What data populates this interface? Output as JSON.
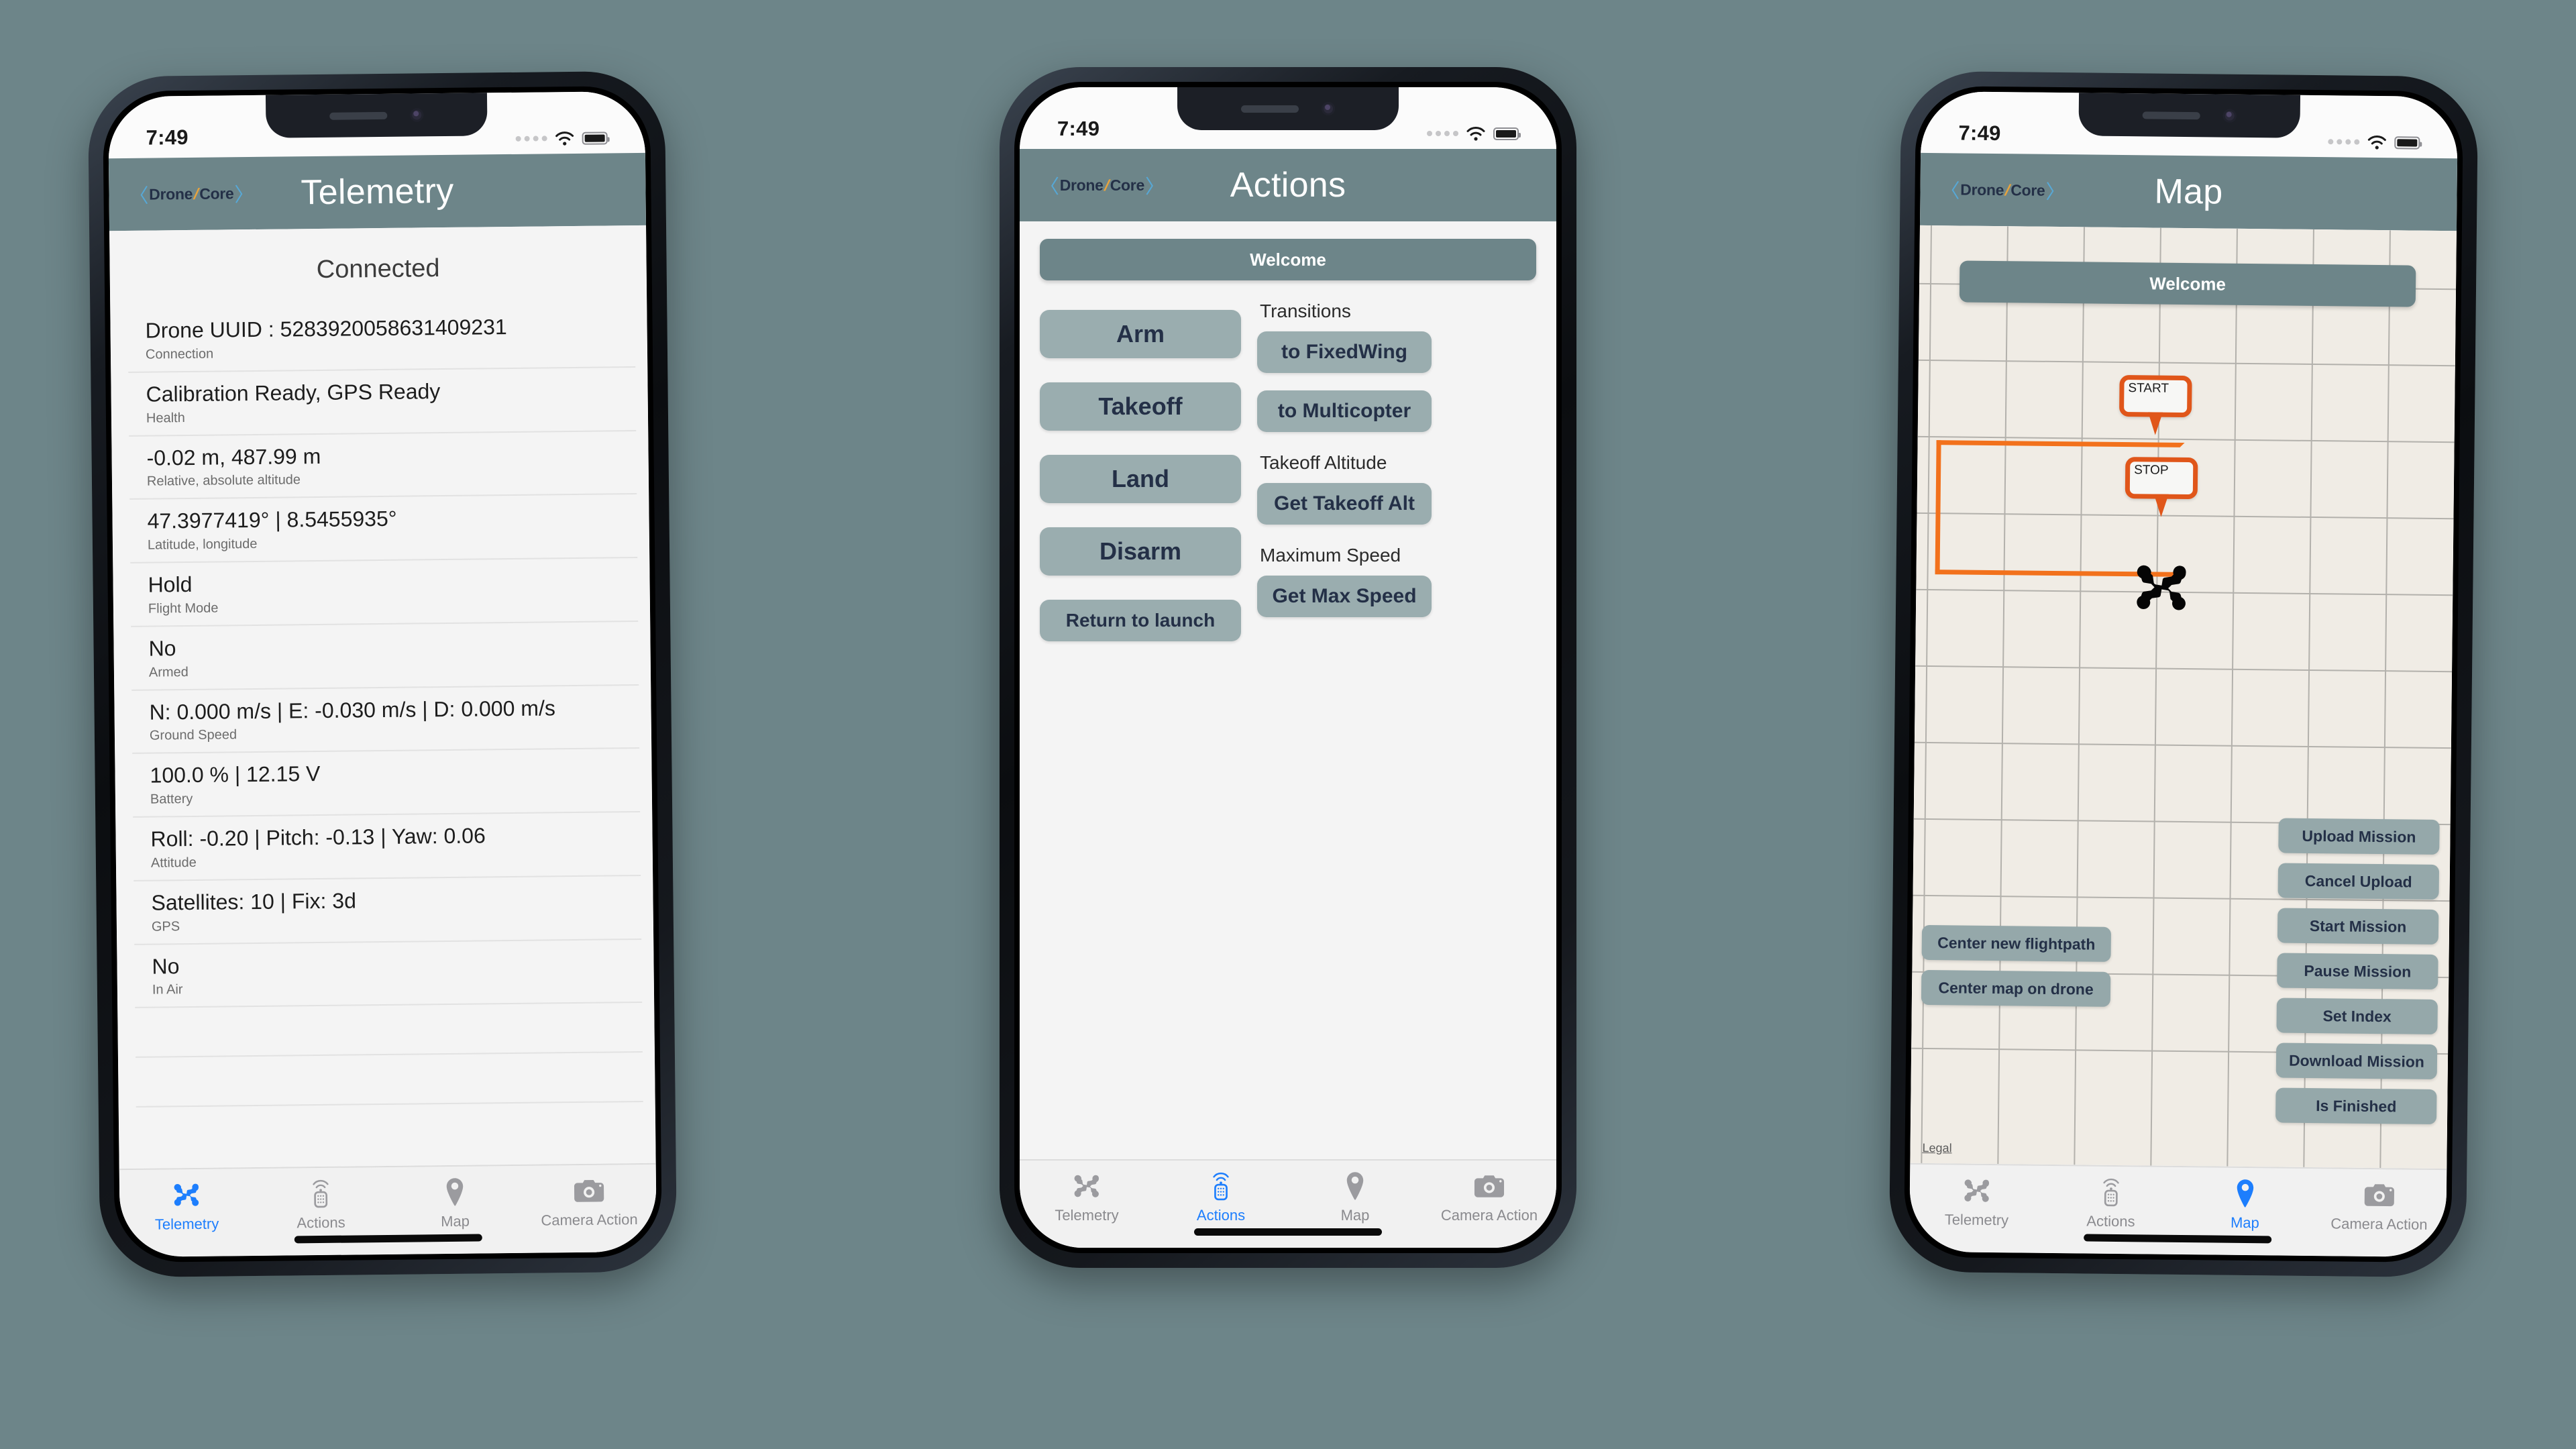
{
  "background_color": "#6d8589",
  "accent_color": "#6d8589",
  "button_color": "#9aadaf",
  "active_tab_color": "#1d7efd",
  "flightpath_color": "#f2711c",
  "status_bar": {
    "time": "7:49"
  },
  "brand": {
    "open_bracket": "〈",
    "first": "Drone",
    "slash": "/",
    "second": "Core",
    "close_bracket": "〉"
  },
  "tabs": [
    {
      "label": "Telemetry",
      "icon": "drone-icon"
    },
    {
      "label": "Actions",
      "icon": "remote-control-icon"
    },
    {
      "label": "Map",
      "icon": "map-pin-icon"
    },
    {
      "label": "Camera Action",
      "icon": "camera-icon"
    }
  ],
  "phone1": {
    "nav_title": "Telemetry",
    "active_tab": "Telemetry",
    "connection_status": "Connected",
    "rows": [
      {
        "value": "Drone UUID : 5283920058631409231",
        "label": "Connection"
      },
      {
        "value": "Calibration Ready, GPS Ready",
        "label": "Health"
      },
      {
        "value": "-0.02 m, 487.99 m",
        "label": "Relative, absolute altitude"
      },
      {
        "value": "47.3977419° | 8.5455935°",
        "label": "Latitude, longitude"
      },
      {
        "value": "Hold",
        "label": "Flight Mode"
      },
      {
        "value": "No",
        "label": "Armed"
      },
      {
        "value": "N: 0.000 m/s | E: -0.030 m/s | D: 0.000 m/s",
        "label": "Ground Speed"
      },
      {
        "value": "100.0 % | 12.15 V",
        "label": "Battery"
      },
      {
        "value": "Roll: -0.20 | Pitch: -0.13 | Yaw: 0.06",
        "label": "Attitude"
      },
      {
        "value": "Satellites: 10 | Fix: 3d",
        "label": "GPS"
      },
      {
        "value": "No",
        "label": "In Air"
      }
    ]
  },
  "phone2": {
    "nav_title": "Actions",
    "active_tab": "Actions",
    "welcome_banner": "Welcome",
    "primary_buttons": [
      {
        "label": "Arm"
      },
      {
        "label": "Takeoff"
      },
      {
        "label": "Land"
      },
      {
        "label": "Disarm"
      },
      {
        "label": "Return to launch"
      }
    ],
    "sections": [
      {
        "label": "Transitions",
        "buttons": [
          {
            "label": "to FixedWing"
          },
          {
            "label": "to Multicopter"
          }
        ]
      },
      {
        "label": "Takeoff Altitude",
        "buttons": [
          {
            "label": "Get Takeoff Alt"
          }
        ]
      },
      {
        "label": "Maximum Speed",
        "buttons": [
          {
            "label": "Get Max Speed"
          }
        ]
      }
    ]
  },
  "phone3": {
    "nav_title": "Map",
    "active_tab": "Map",
    "welcome_banner": "Welcome",
    "map_markers": [
      {
        "label": "START"
      },
      {
        "label": "STOP"
      }
    ],
    "drone_marker": "drone-icon",
    "left_buttons": [
      {
        "label": "Center new flightpath"
      },
      {
        "label": "Center map on drone"
      }
    ],
    "right_buttons": [
      {
        "label": "Upload Mission"
      },
      {
        "label": "Cancel Upload"
      },
      {
        "label": "Start Mission"
      },
      {
        "label": "Pause Mission"
      },
      {
        "label": "Set Index"
      },
      {
        "label": "Download Mission"
      },
      {
        "label": "Is Finished"
      }
    ],
    "legal_link": "Legal"
  }
}
